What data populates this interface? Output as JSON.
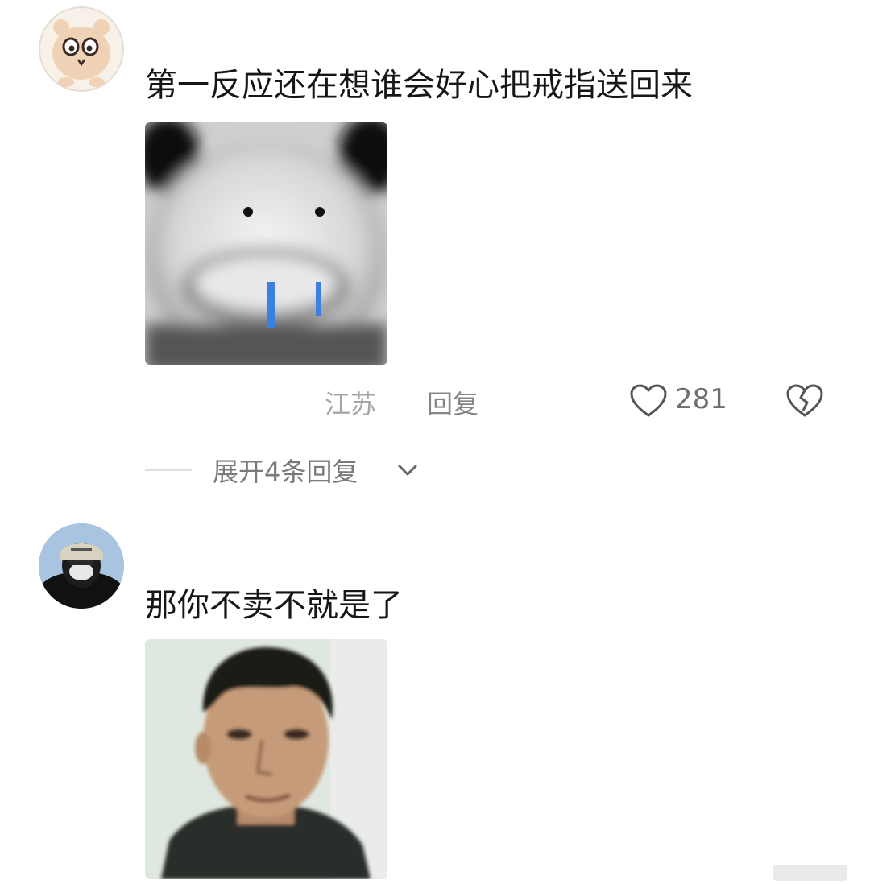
{
  "comments": [
    {
      "text": "第一反应还在想谁会好心把戒指送回来",
      "location": "江苏",
      "reply_label": "回复",
      "like_count": "281",
      "expand_label": "展开4条回复",
      "avatar_icon": "cartoon-bear-avatar",
      "image_icon": "blurred-crying-panda-sticker"
    },
    {
      "text": "那你不卖不就是了",
      "avatar_icon": "masked-person-avatar",
      "image_icon": "man-portrait-meme"
    }
  ],
  "colors": {
    "text": "#161616",
    "meta": "#9a9a9a",
    "tear_blue": "#3d7fe0"
  }
}
